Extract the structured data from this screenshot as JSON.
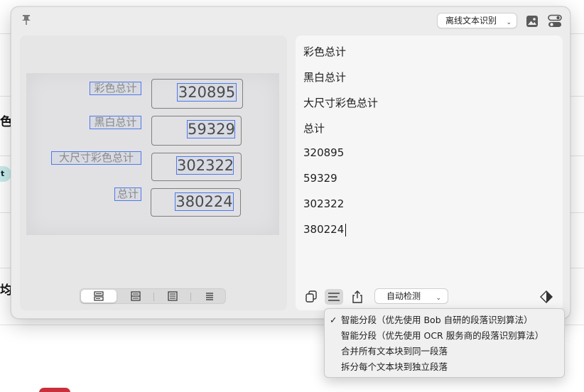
{
  "background": {
    "edge_text_1": "色",
    "edge_text_2": "t",
    "edge_text_3": "均"
  },
  "window": {
    "ocr_service": "离线文本识别",
    "icons": {
      "pin": "pin-icon",
      "image": "image-icon",
      "toggle": "toggle-panel-icon"
    }
  },
  "photo": {
    "labels": [
      "彩色总计",
      "黑白总计",
      "大尺寸彩色总计",
      "总计"
    ],
    "numbers": [
      "320895",
      "59329",
      "302322",
      "380224"
    ]
  },
  "result": {
    "lines": [
      "彩色总计",
      "黑白总计",
      "大尺寸彩色总计",
      "总计",
      "320895",
      "59329",
      "302322",
      "380224"
    ]
  },
  "toolbar": {
    "language": "自动检测"
  },
  "menu": {
    "items": [
      {
        "label": "智能分段（优先使用 Bob 自研的段落识别算法）",
        "checked": true
      },
      {
        "label": "智能分段（优先使用 OCR 服务商的段落识别算法）",
        "checked": false
      },
      {
        "label": "合并所有文本块到同一段落",
        "checked": false
      },
      {
        "label": "拆分每个文本块到独立段落",
        "checked": false
      }
    ],
    "check_mark": "✓"
  },
  "colors": {
    "highlight_box": "#4f79e8",
    "window_bg": "#ececec"
  }
}
